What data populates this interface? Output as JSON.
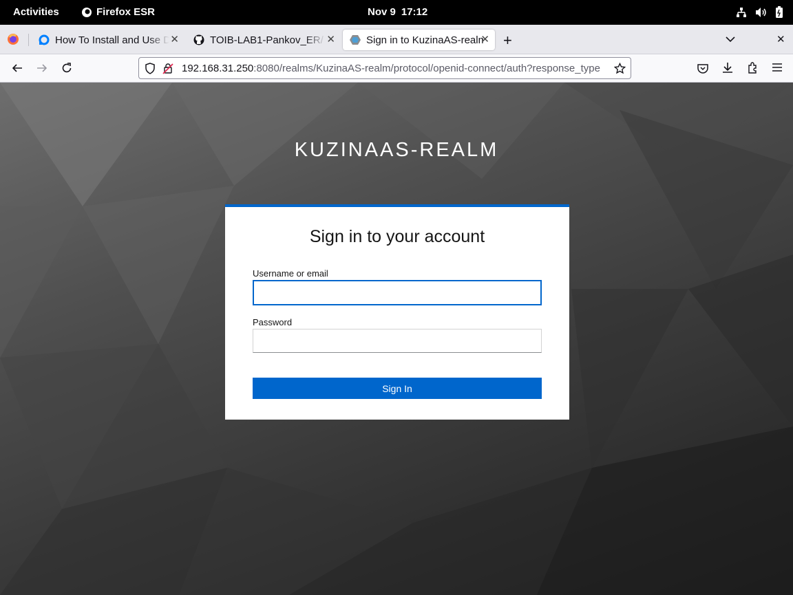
{
  "topbar": {
    "activities": "Activities",
    "app_name": "Firefox ESR",
    "date": "Nov 9",
    "time": "17:12"
  },
  "tabs": [
    {
      "title": "How To Install and Use Do",
      "icon": "digitalocean-icon"
    },
    {
      "title": "TOIB-LAB1-Pankov_ER/N",
      "icon": "github-icon"
    },
    {
      "title": "Sign in to KuzinaAS-realm",
      "icon": "keycloak-icon",
      "active": true
    }
  ],
  "urlbar": {
    "host": "192.168.31.250",
    "rest": ":8080/realms/KuzinaAS-realm/protocol/openid-connect/auth?response_type"
  },
  "page": {
    "realm_name": "KUZINAAS-REALM",
    "card_title": "Sign in to your account",
    "username_label": "Username or email",
    "username_value": "",
    "password_label": "Password",
    "password_value": "",
    "signin_label": "Sign In"
  },
  "colors": {
    "accent": "#0066cc",
    "topbar_bg": "#000000"
  }
}
